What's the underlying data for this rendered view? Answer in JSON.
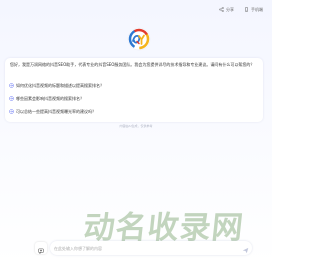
{
  "header": {
    "share_label": "分享",
    "mobile_label": "手机端"
  },
  "logo": {
    "name": "QY-logo",
    "colors": [
      "#2d78d2",
      "#e23c2f",
      "#f5b51d"
    ]
  },
  "greeting": {
    "text": "您好，我是万润网络的抖音SEO助手，代表专业的抖音SEO服务团队。我会为您提供详尽的技术指导和专业建议。请问有什么可以帮您的？"
  },
  "suggestions": [
    {
      "icon": "arrow-icon",
      "label": "如何优化抖音视频的标题和描述以提高搜索排名？"
    },
    {
      "icon": "arrow-icon",
      "label": "哪些因素会影响抖音视频的搜索排名？"
    },
    {
      "icon": "arrow-icon",
      "label": "可以总结一些提高抖音视频曝光率的建议吗？"
    }
  ],
  "disclaimer": "内容由AI生成，仅供参考",
  "input": {
    "placeholder": "在此处输入你想了解的内容"
  },
  "watermark": "动名收录网",
  "colors": {
    "accent": "#5b6cf2",
    "background": "#f5f7ff"
  }
}
